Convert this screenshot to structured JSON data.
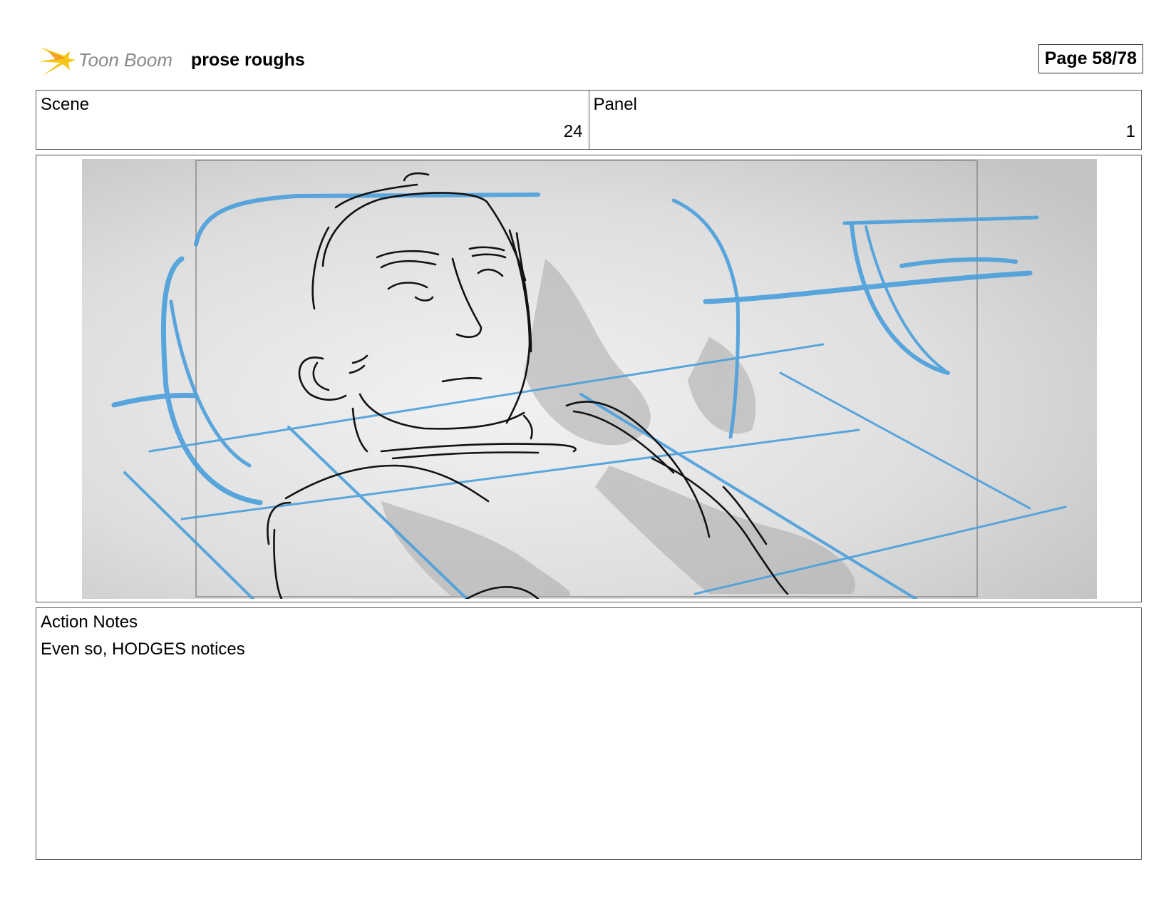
{
  "header": {
    "logo_text": "Toon Boom",
    "title": "prose roughs",
    "page_label": "Page 58/78"
  },
  "scene": {
    "label": "Scene",
    "value": "24"
  },
  "panel": {
    "label": "Panel",
    "value": "1"
  },
  "action_notes": {
    "label": "Action Notes",
    "text": "Even so, HODGES notices"
  },
  "colors": {
    "sketch_blue": "#4a9fdc",
    "ink": "#111111",
    "logo_star": "#f5c518"
  },
  "icons": {
    "logo": "toon-boom-star-icon"
  }
}
